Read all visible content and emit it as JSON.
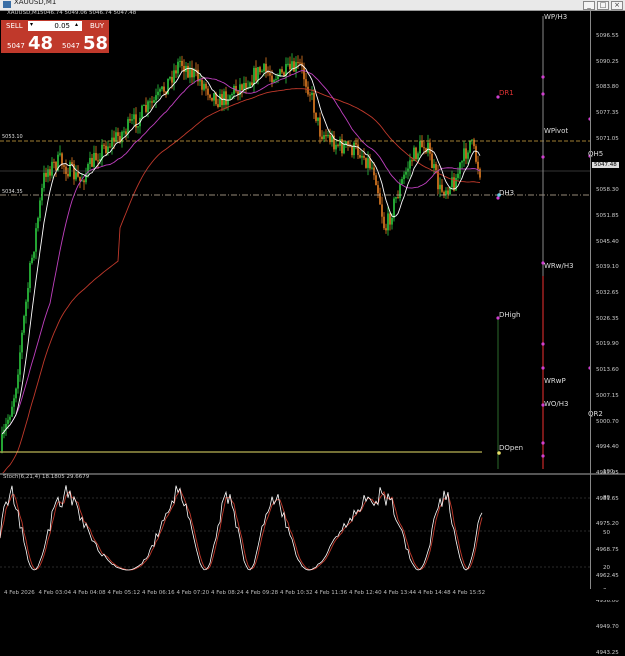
{
  "window": {
    "title": "XAUUSD,M1"
  },
  "ohlc": "5046.74 5049.06 5046.74 5047.48",
  "trade_panel": {
    "sell_label": "SELL",
    "buy_label": "BUY",
    "lot": "0.05",
    "sell_prefix": "5047",
    "sell_big": "48",
    "buy_prefix": "5047",
    "buy_big": "58"
  },
  "price_axis": [
    "5096.55",
    "5090.25",
    "5083.80",
    "5077.35",
    "5071.05",
    "5064.60",
    "5058.30",
    "5051.85",
    "5045.40",
    "5039.10",
    "5032.65",
    "5026.35",
    "5019.90",
    "5013.60",
    "5007.15",
    "5000.70",
    "4994.40",
    "4987.95",
    "4981.65",
    "4975.20",
    "4968.75",
    "4962.45",
    "4956.00",
    "4949.70",
    "4943.25"
  ],
  "current_price": "5047.48",
  "indicator": {
    "label": "Stoch(6,21,4) 18.1805 29.6679",
    "levels": [
      "100",
      "80",
      "50",
      "20",
      "0"
    ]
  },
  "time_axis": [
    "4 Feb 2026",
    "4 Feb 03:04",
    "4 Feb 04:08",
    "4 Feb 05:12",
    "4 Feb 06:16",
    "4 Feb 07:20",
    "4 Feb 08:24",
    "4 Feb 09:28",
    "4 Feb 10:32",
    "4 Feb 11:36",
    "4 Feb 12:40",
    "4 Feb 13:44",
    "4 Feb 14:48",
    "4 Feb 15:52"
  ],
  "hline_labels": {
    "upper": "5053.10",
    "lower": "5034.35"
  },
  "pivots": [
    {
      "label": "WP/H3",
      "color": "#ddd"
    },
    {
      "label": "DR1",
      "color": "#d33"
    },
    {
      "label": "WPivot",
      "color": "#ddd"
    },
    {
      "label": "QH5",
      "color": "#ddd"
    },
    {
      "label": "DH3",
      "color": "#ddd"
    },
    {
      "label": "WRw/H3",
      "color": "#ddd"
    },
    {
      "label": "DHigh",
      "color": "#ddd"
    },
    {
      "label": "WRwP",
      "color": "#ddd"
    },
    {
      "label": "WO/H3",
      "color": "#ddd"
    },
    {
      "label": "QR2",
      "color": "#ddd"
    },
    {
      "label": "DOpen",
      "color": "#ddd"
    }
  ],
  "colors": {
    "bull": "#2ecc40",
    "bear": "#e67e22",
    "ma_fast": "#ffffff",
    "ma_mid": "#c040c0",
    "ma_slow": "#c0392b",
    "stoch_main": "#ffffff",
    "stoch_signal": "#c0392b",
    "yellow": "#e8e06a"
  }
}
